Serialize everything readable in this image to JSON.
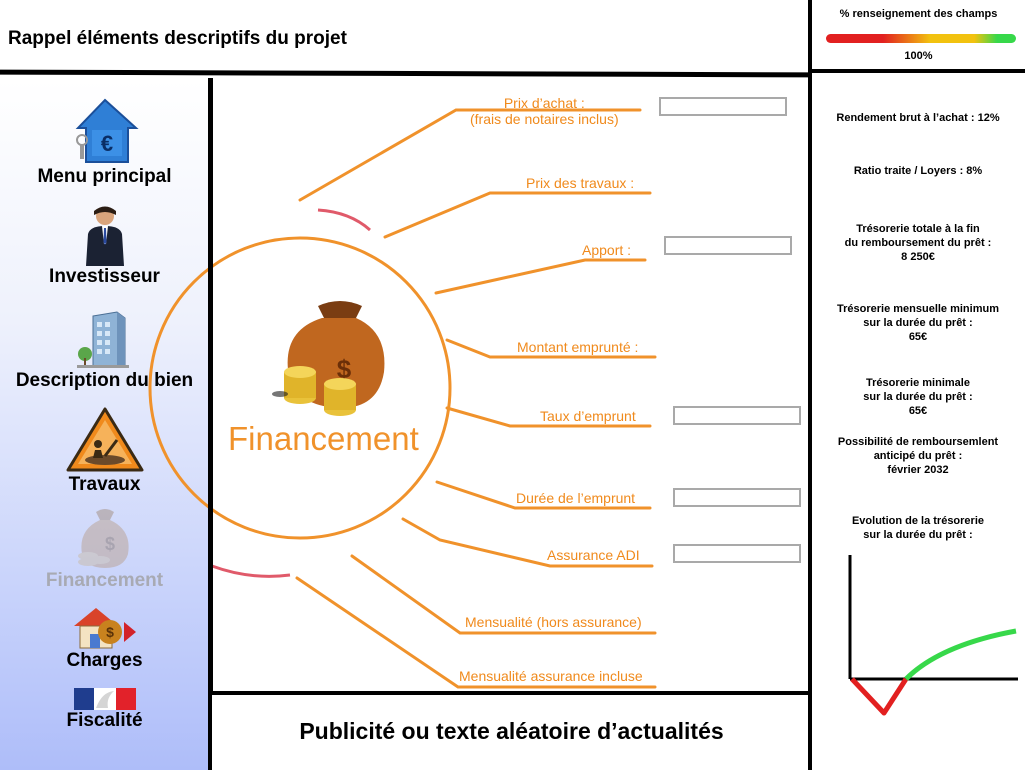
{
  "header": {
    "title": "Rappel éléments descriptifs du projet",
    "progress_label": "% renseignement des champs",
    "progress_value": "100%",
    "progress_fraction": 1.0
  },
  "sidebar": {
    "items": [
      {
        "label": "Menu principal",
        "icon": "house-euro-icon"
      },
      {
        "label": "Investisseur",
        "icon": "businessman-icon"
      },
      {
        "label": "Description du bien",
        "icon": "building-icon"
      },
      {
        "label": "Travaux",
        "icon": "construction-sign-icon"
      },
      {
        "label": "Financement",
        "icon": "money-bag-icon",
        "active": true
      },
      {
        "label": "Charges",
        "icon": "house-money-icon"
      },
      {
        "label": "Fiscalité",
        "icon": "french-republic-logo-icon"
      }
    ]
  },
  "main": {
    "center_title": "Financement",
    "fields": [
      {
        "label": "Prix d’achat :\n(frais de notaires inclus)",
        "value": ""
      },
      {
        "label": "Prix des travaux :"
      },
      {
        "label": "Apport :",
        "value": ""
      },
      {
        "label": "Montant emprunté :"
      },
      {
        "label": "Taux d’emprunt",
        "value": ""
      },
      {
        "label": "Durée de l’emprunt",
        "value": ""
      },
      {
        "label": "Assurance ADI",
        "value": ""
      },
      {
        "label": "Mensualité (hors assurance)"
      },
      {
        "label": "Mensualité assurance incluse"
      }
    ]
  },
  "right_panel": {
    "rendement": "Rendement brut à l’achat : 12%",
    "ratio": "Ratio traite / Loyers : 8%",
    "tresorerie_totale": "Trésorerie totale à la fin\ndu remboursement du prêt :\n8 250€",
    "tresorerie_mensuelle": "Trésorerie mensuelle minimum\nsur la durée du prêt :\n65€",
    "tresorerie_minimale": "Trésorerie minimale\nsur la durée du prêt :\n65€",
    "remboursement": "Possibilité de remboursemlent\nanticipé du prêt :\nfévrier 2032",
    "evolution_title": "Evolution de la trésorerie\nsur la durée du prêt :"
  },
  "footer": {
    "ad_text": "Publicité ou texte aléatoire d’actualités"
  },
  "colors": {
    "accent_orange": "#f08a1c",
    "sidebar_gradient_end": "#aebdf9",
    "trend_negative": "#e22020",
    "trend_positive": "#37d84a"
  }
}
